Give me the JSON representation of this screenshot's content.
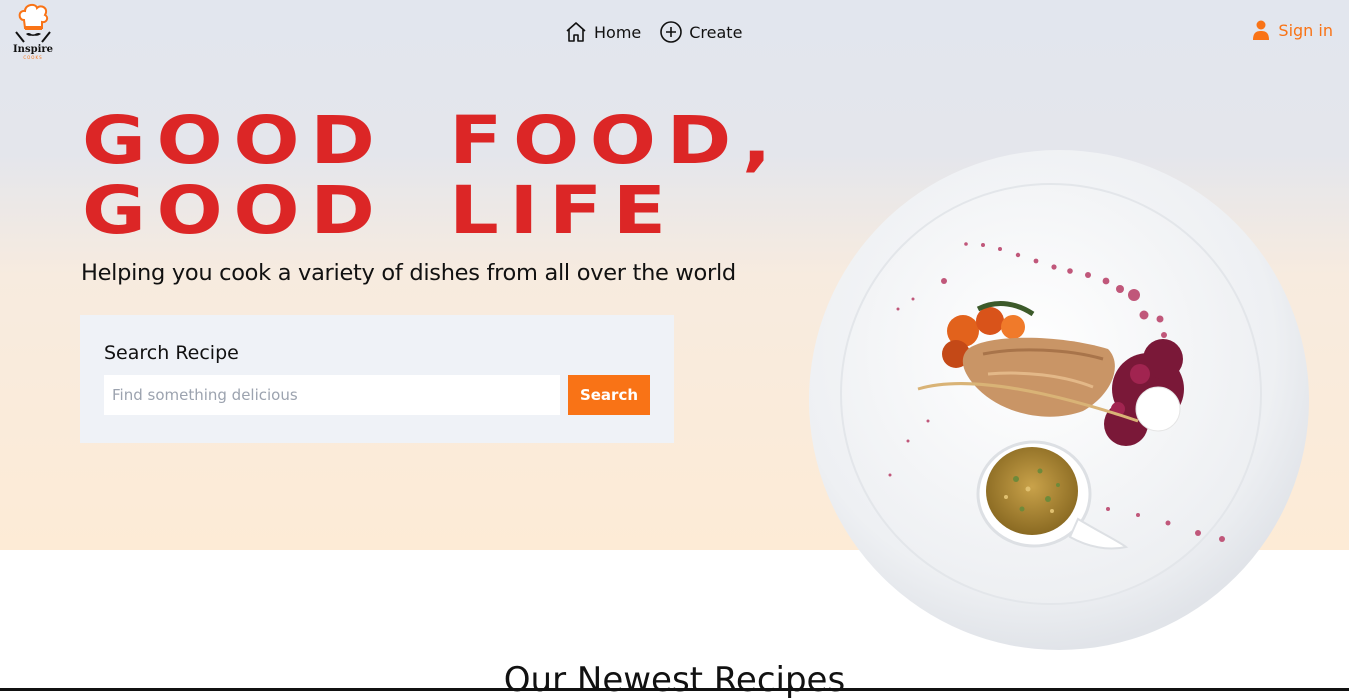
{
  "brand": {
    "name": "Inspire",
    "tagline": "COOKS"
  },
  "nav": {
    "items": [
      {
        "label": "Home",
        "icon": "home-icon"
      },
      {
        "label": "Create",
        "icon": "plus-circle-icon"
      }
    ],
    "signin_label": "Sign in",
    "signin_icon": "user-icon"
  },
  "hero": {
    "headline_line1": "GOOD FOOD,",
    "headline_line2": "GOOD LIFE",
    "subtitle": "Helping you cook a variety of dishes from all over the world"
  },
  "search": {
    "label": "Search Recipe",
    "placeholder": "Find something delicious",
    "value": "",
    "button_label": "Search"
  },
  "sections": {
    "newest_title": "Our Newest Recipes"
  },
  "colors": {
    "accent": "#f97316",
    "headline": "#dc2626",
    "card_background": "#eff2f7"
  }
}
